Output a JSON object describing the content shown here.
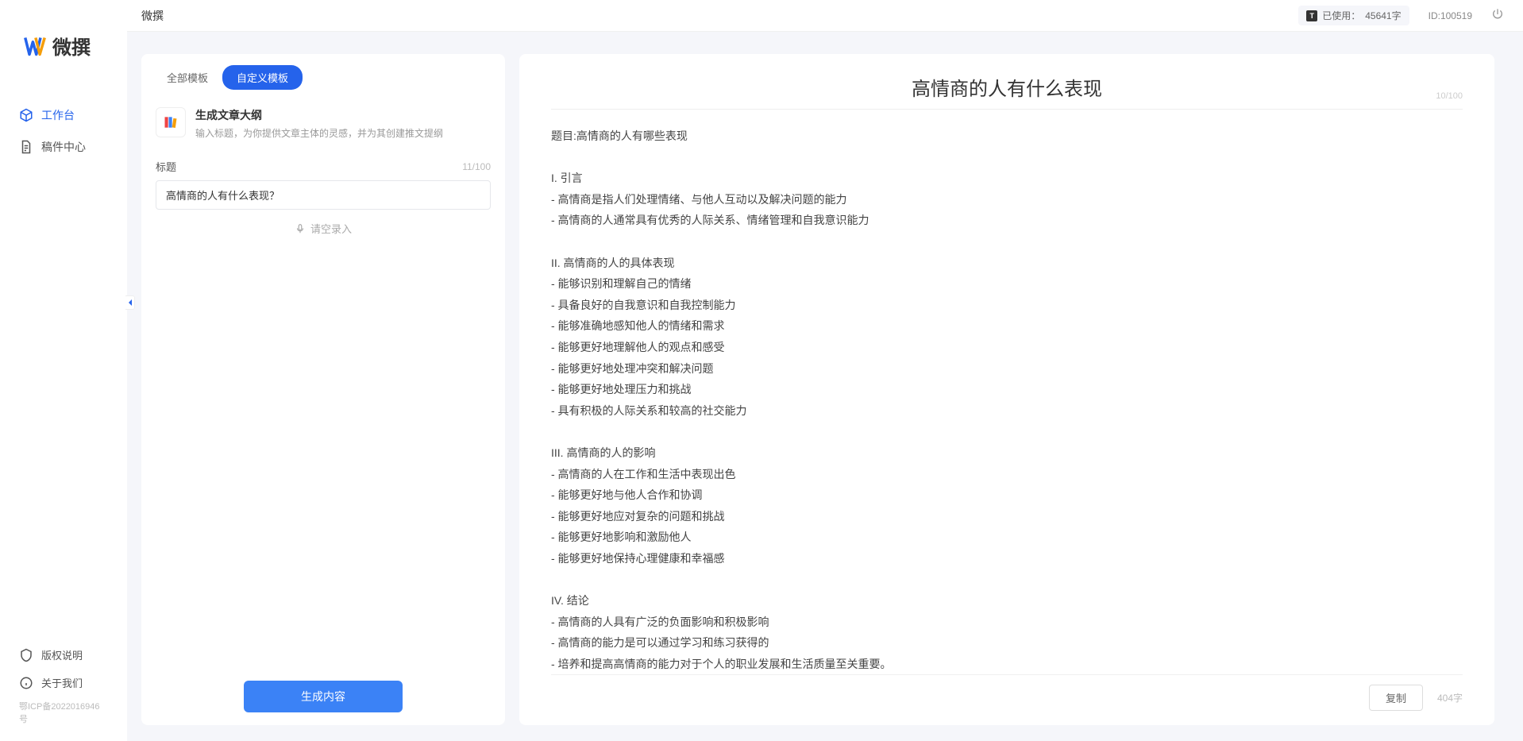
{
  "brand": "微撰",
  "topbar": {
    "app_name": "微撰",
    "usage_label": "已使用：",
    "usage_value": "45641字",
    "user_id": "ID:100519"
  },
  "sidebar": {
    "nav": [
      {
        "label": "工作台",
        "active": true
      },
      {
        "label": "稿件中心",
        "active": false
      }
    ],
    "bottom": [
      {
        "label": "版权说明"
      },
      {
        "label": "关于我们"
      }
    ],
    "icp": "鄂ICP备2022016946号"
  },
  "left": {
    "tabs": [
      {
        "label": "全部模板",
        "active": false
      },
      {
        "label": "自定义模板",
        "active": true
      }
    ],
    "template": {
      "title": "生成文章大纲",
      "desc": "输入标题，为你提供文章主体的灵感，并为其创建推文提纲"
    },
    "form": {
      "label": "标题",
      "count": "11/100",
      "value": "高情商的人有什么表现？",
      "voice_hint": "请空录入"
    },
    "generate": "生成内容"
  },
  "right": {
    "title": "高情商的人有什么表现",
    "title_count": "10/100",
    "body": "题目:高情商的人有哪些表现\n\nI. 引言\n- 高情商是指人们处理情绪、与他人互动以及解决问题的能力\n- 高情商的人通常具有优秀的人际关系、情绪管理和自我意识能力\n\nII. 高情商的人的具体表现\n- 能够识别和理解自己的情绪\n- 具备良好的自我意识和自我控制能力\n- 能够准确地感知他人的情绪和需求\n- 能够更好地理解他人的观点和感受\n- 能够更好地处理冲突和解决问题\n- 能够更好地处理压力和挑战\n- 具有积极的人际关系和较高的社交能力\n\nIII. 高情商的人的影响\n- 高情商的人在工作和生活中表现出色\n- 能够更好地与他人合作和协调\n- 能够更好地应对复杂的问题和挑战\n- 能够更好地影响和激励他人\n- 能够更好地保持心理健康和幸福感\n\nIV. 结论\n- 高情商的人具有广泛的负面影响和积极影响\n- 高情商的能力是可以通过学习和练习获得的\n- 培养和提高高情商的能力对于个人的职业发展和生活质量至关重要。",
    "copy": "复制",
    "word_count": "404字"
  }
}
